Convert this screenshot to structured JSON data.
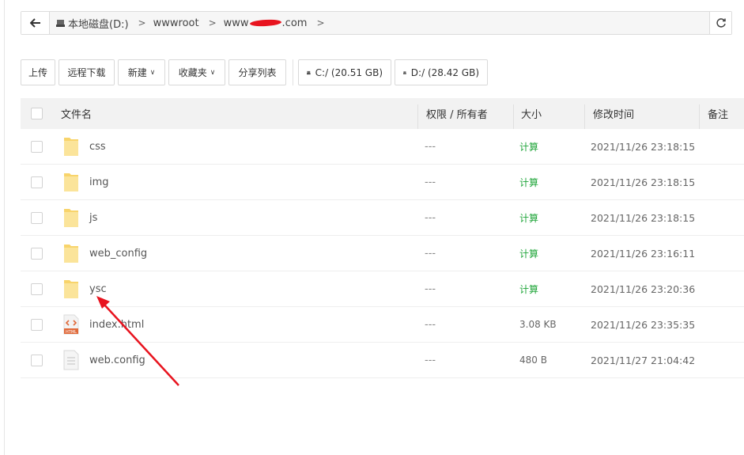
{
  "address_bar": {
    "crumbs": [
      "本地磁盘(D:)",
      "wwwroot"
    ],
    "domain_prefix": "www",
    "domain_suffix": ".com"
  },
  "toolbar": {
    "upload": "上传",
    "remote_download": "远程下载",
    "new": "新建",
    "favorites": "收藏夹",
    "share_list": "分享列表",
    "drives": [
      {
        "label": "C:/ (20.51 GB)"
      },
      {
        "label": "D:/ (28.42 GB)"
      }
    ]
  },
  "table": {
    "headers": {
      "name": "文件名",
      "perm": "权限 / 所有者",
      "size": "大小",
      "mtime": "修改时间",
      "note": "备注"
    },
    "rows": [
      {
        "name": "css",
        "type": "folder",
        "perm": "---",
        "size": "计算",
        "mtime": "2021/11/26 23:18:15"
      },
      {
        "name": "img",
        "type": "folder",
        "perm": "---",
        "size": "计算",
        "mtime": "2021/11/26 23:18:15"
      },
      {
        "name": "js",
        "type": "folder",
        "perm": "---",
        "size": "计算",
        "mtime": "2021/11/26 23:18:15"
      },
      {
        "name": "web_config",
        "type": "folder",
        "perm": "---",
        "size": "计算",
        "mtime": "2021/11/26 23:16:11"
      },
      {
        "name": "ysc",
        "type": "folder",
        "perm": "---",
        "size": "计算",
        "mtime": "2021/11/26 23:20:36"
      },
      {
        "name": "index.html",
        "type": "html",
        "perm": "---",
        "size": "3.08 KB",
        "mtime": "2021/11/26 23:35:35"
      },
      {
        "name": "web.config",
        "type": "file",
        "perm": "---",
        "size": "480 B",
        "mtime": "2021/11/27 21:04:42"
      }
    ]
  },
  "colors": {
    "accent_green": "#20a53a",
    "folder_yellow": "#f8d46b",
    "annotation_red": "#e8141f"
  }
}
